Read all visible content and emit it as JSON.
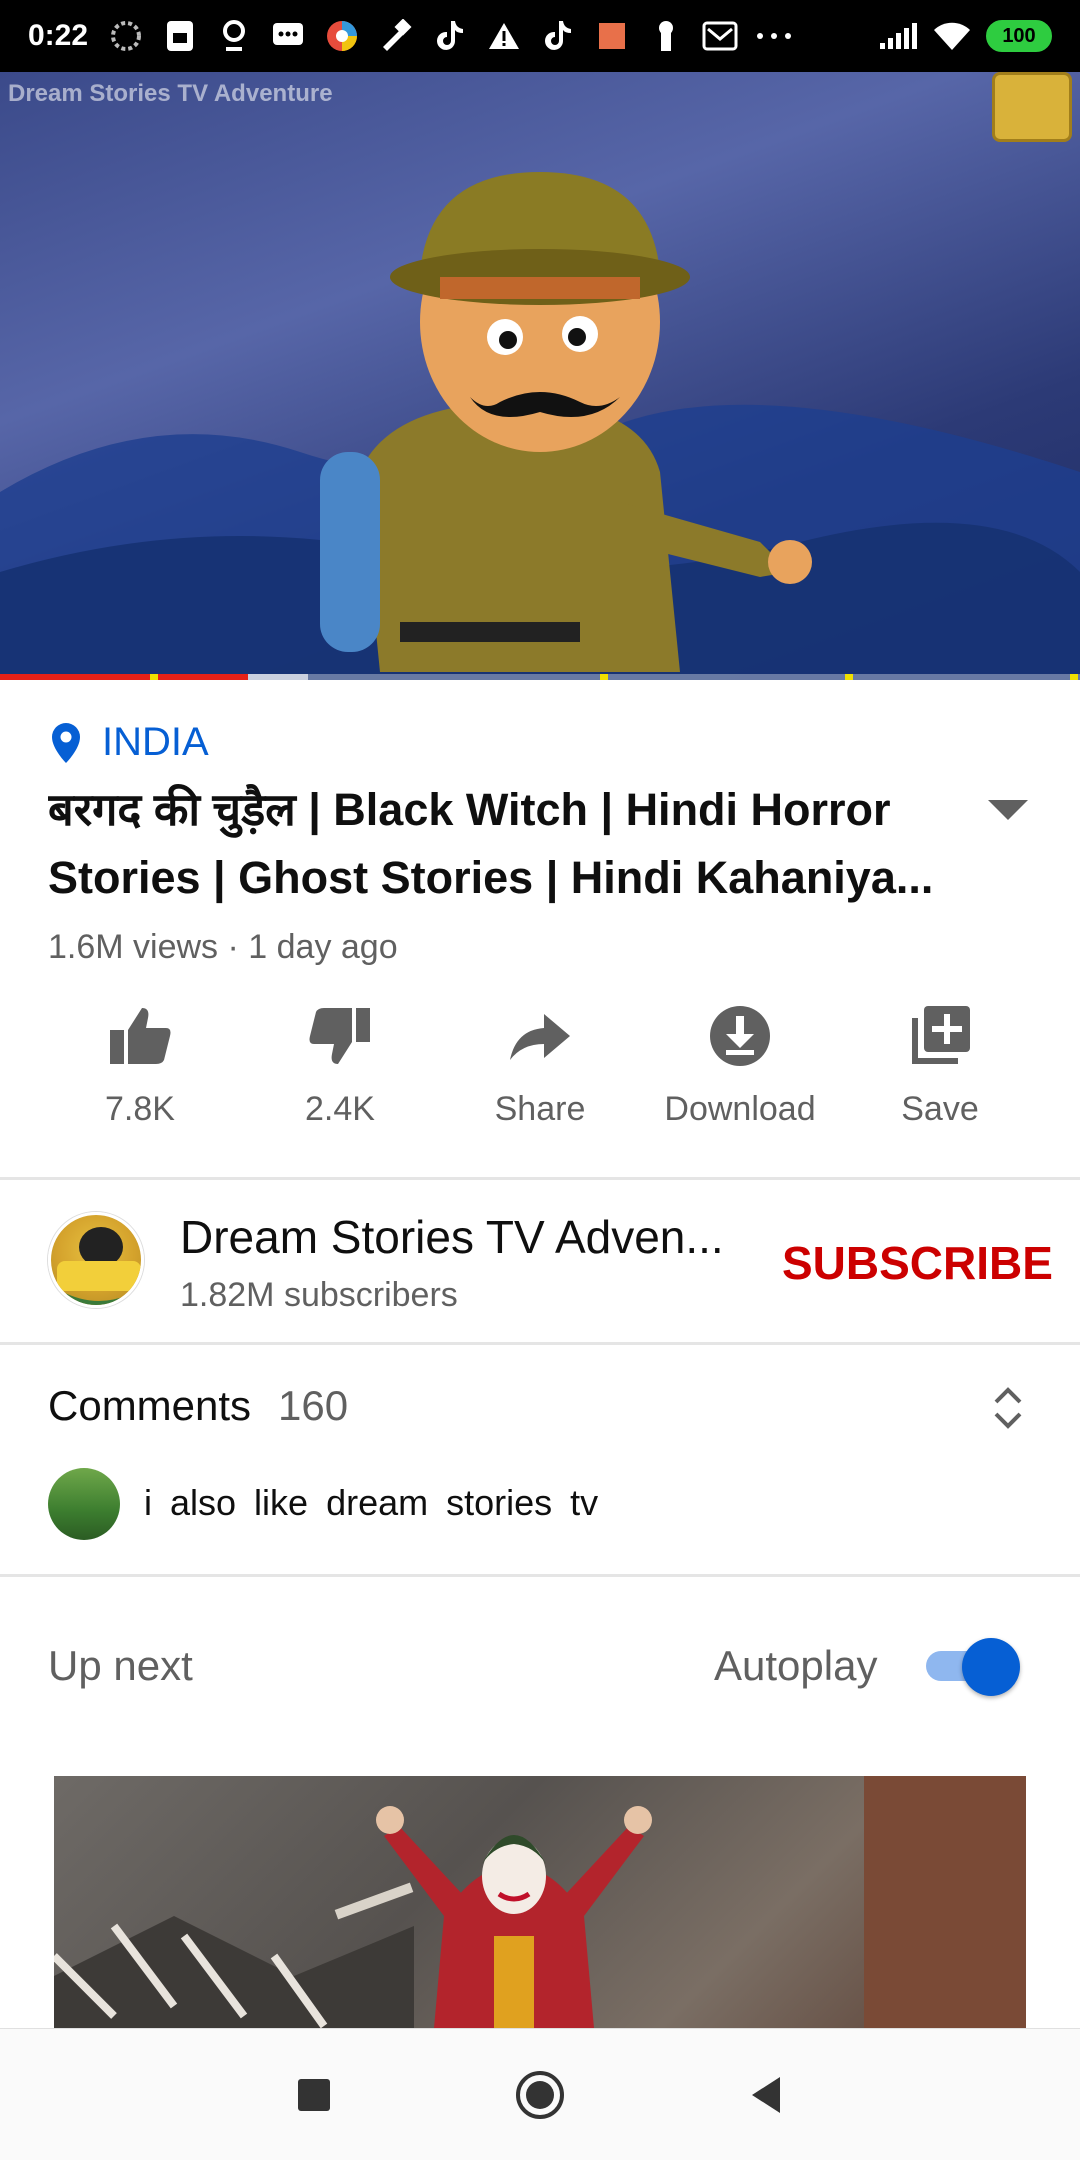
{
  "status_bar": {
    "time": "0:22",
    "battery": "100"
  },
  "video": {
    "watermark": "Dream Stories TV Adventure",
    "progress_played": 0.23,
    "accent_color": "#e62117"
  },
  "info": {
    "location": "INDIA",
    "title": "बरगद की चुड़ैल | Black Witch | Hindi Horror Stories | Ghost Stories | Hindi Kahaniya...",
    "meta": "1.6M views · 1 day ago"
  },
  "actions": [
    {
      "label": "7.8K",
      "icon": "thumbs-up-icon"
    },
    {
      "label": "2.4K",
      "icon": "thumbs-down-icon"
    },
    {
      "label": "Share",
      "icon": "share-icon"
    },
    {
      "label": "Download",
      "icon": "download-icon"
    },
    {
      "label": "Save",
      "icon": "add-to-playlist-icon"
    }
  ],
  "channel": {
    "name": "Dream Stories TV Adven...",
    "subscribers": "1.82M subscribers",
    "subscribe_label": "SUBSCRIBE"
  },
  "comments": {
    "heading": "Comments",
    "count": "160",
    "top_comment": "i also like dream stories tv"
  },
  "up_next": {
    "label": "Up next",
    "autoplay_label": "Autoplay",
    "autoplay_on": true
  }
}
